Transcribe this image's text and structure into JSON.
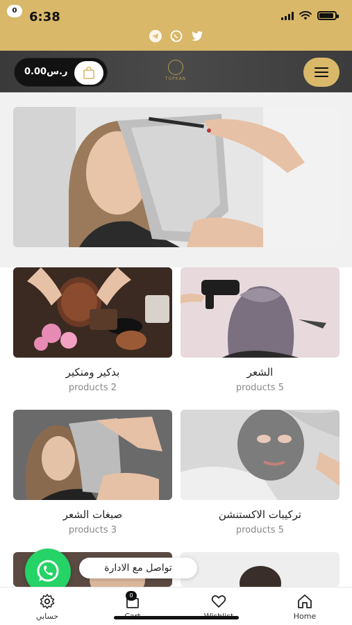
{
  "status_bar": {
    "time": "6:38"
  },
  "socials": [
    "telegram-icon",
    "whatsapp-icon",
    "twitter-icon"
  ],
  "header": {
    "cart_amount": "0.00ر.س",
    "cart_count": "0",
    "logo_text": "TOPKAN",
    "menu_icon": "hamburger-icon"
  },
  "categories": [
    {
      "title": "الشعر",
      "subtitle": "products 5",
      "image": "hair-dryer-photo"
    },
    {
      "title": "بدكير ومنكير",
      "subtitle": "products 2",
      "image": "face-mask-spa-photo"
    },
    {
      "title": "تركيبات الاكستنشن",
      "subtitle": "products 5",
      "image": "clay-mask-photo"
    },
    {
      "title": "صبغات الشعر",
      "subtitle": "products 3",
      "image": "hair-foil-photo"
    }
  ],
  "whatsapp": {
    "label": "تواصل مع الادارة"
  },
  "bottom_nav": {
    "home": "Home",
    "wishlist": "Wishlist",
    "cart": "Cart",
    "cart_count": "0",
    "account": "حسابي"
  },
  "colors": {
    "gold": "#d9b86a",
    "whatsapp": "#25d366",
    "header_dark": "#3f3f3f"
  }
}
